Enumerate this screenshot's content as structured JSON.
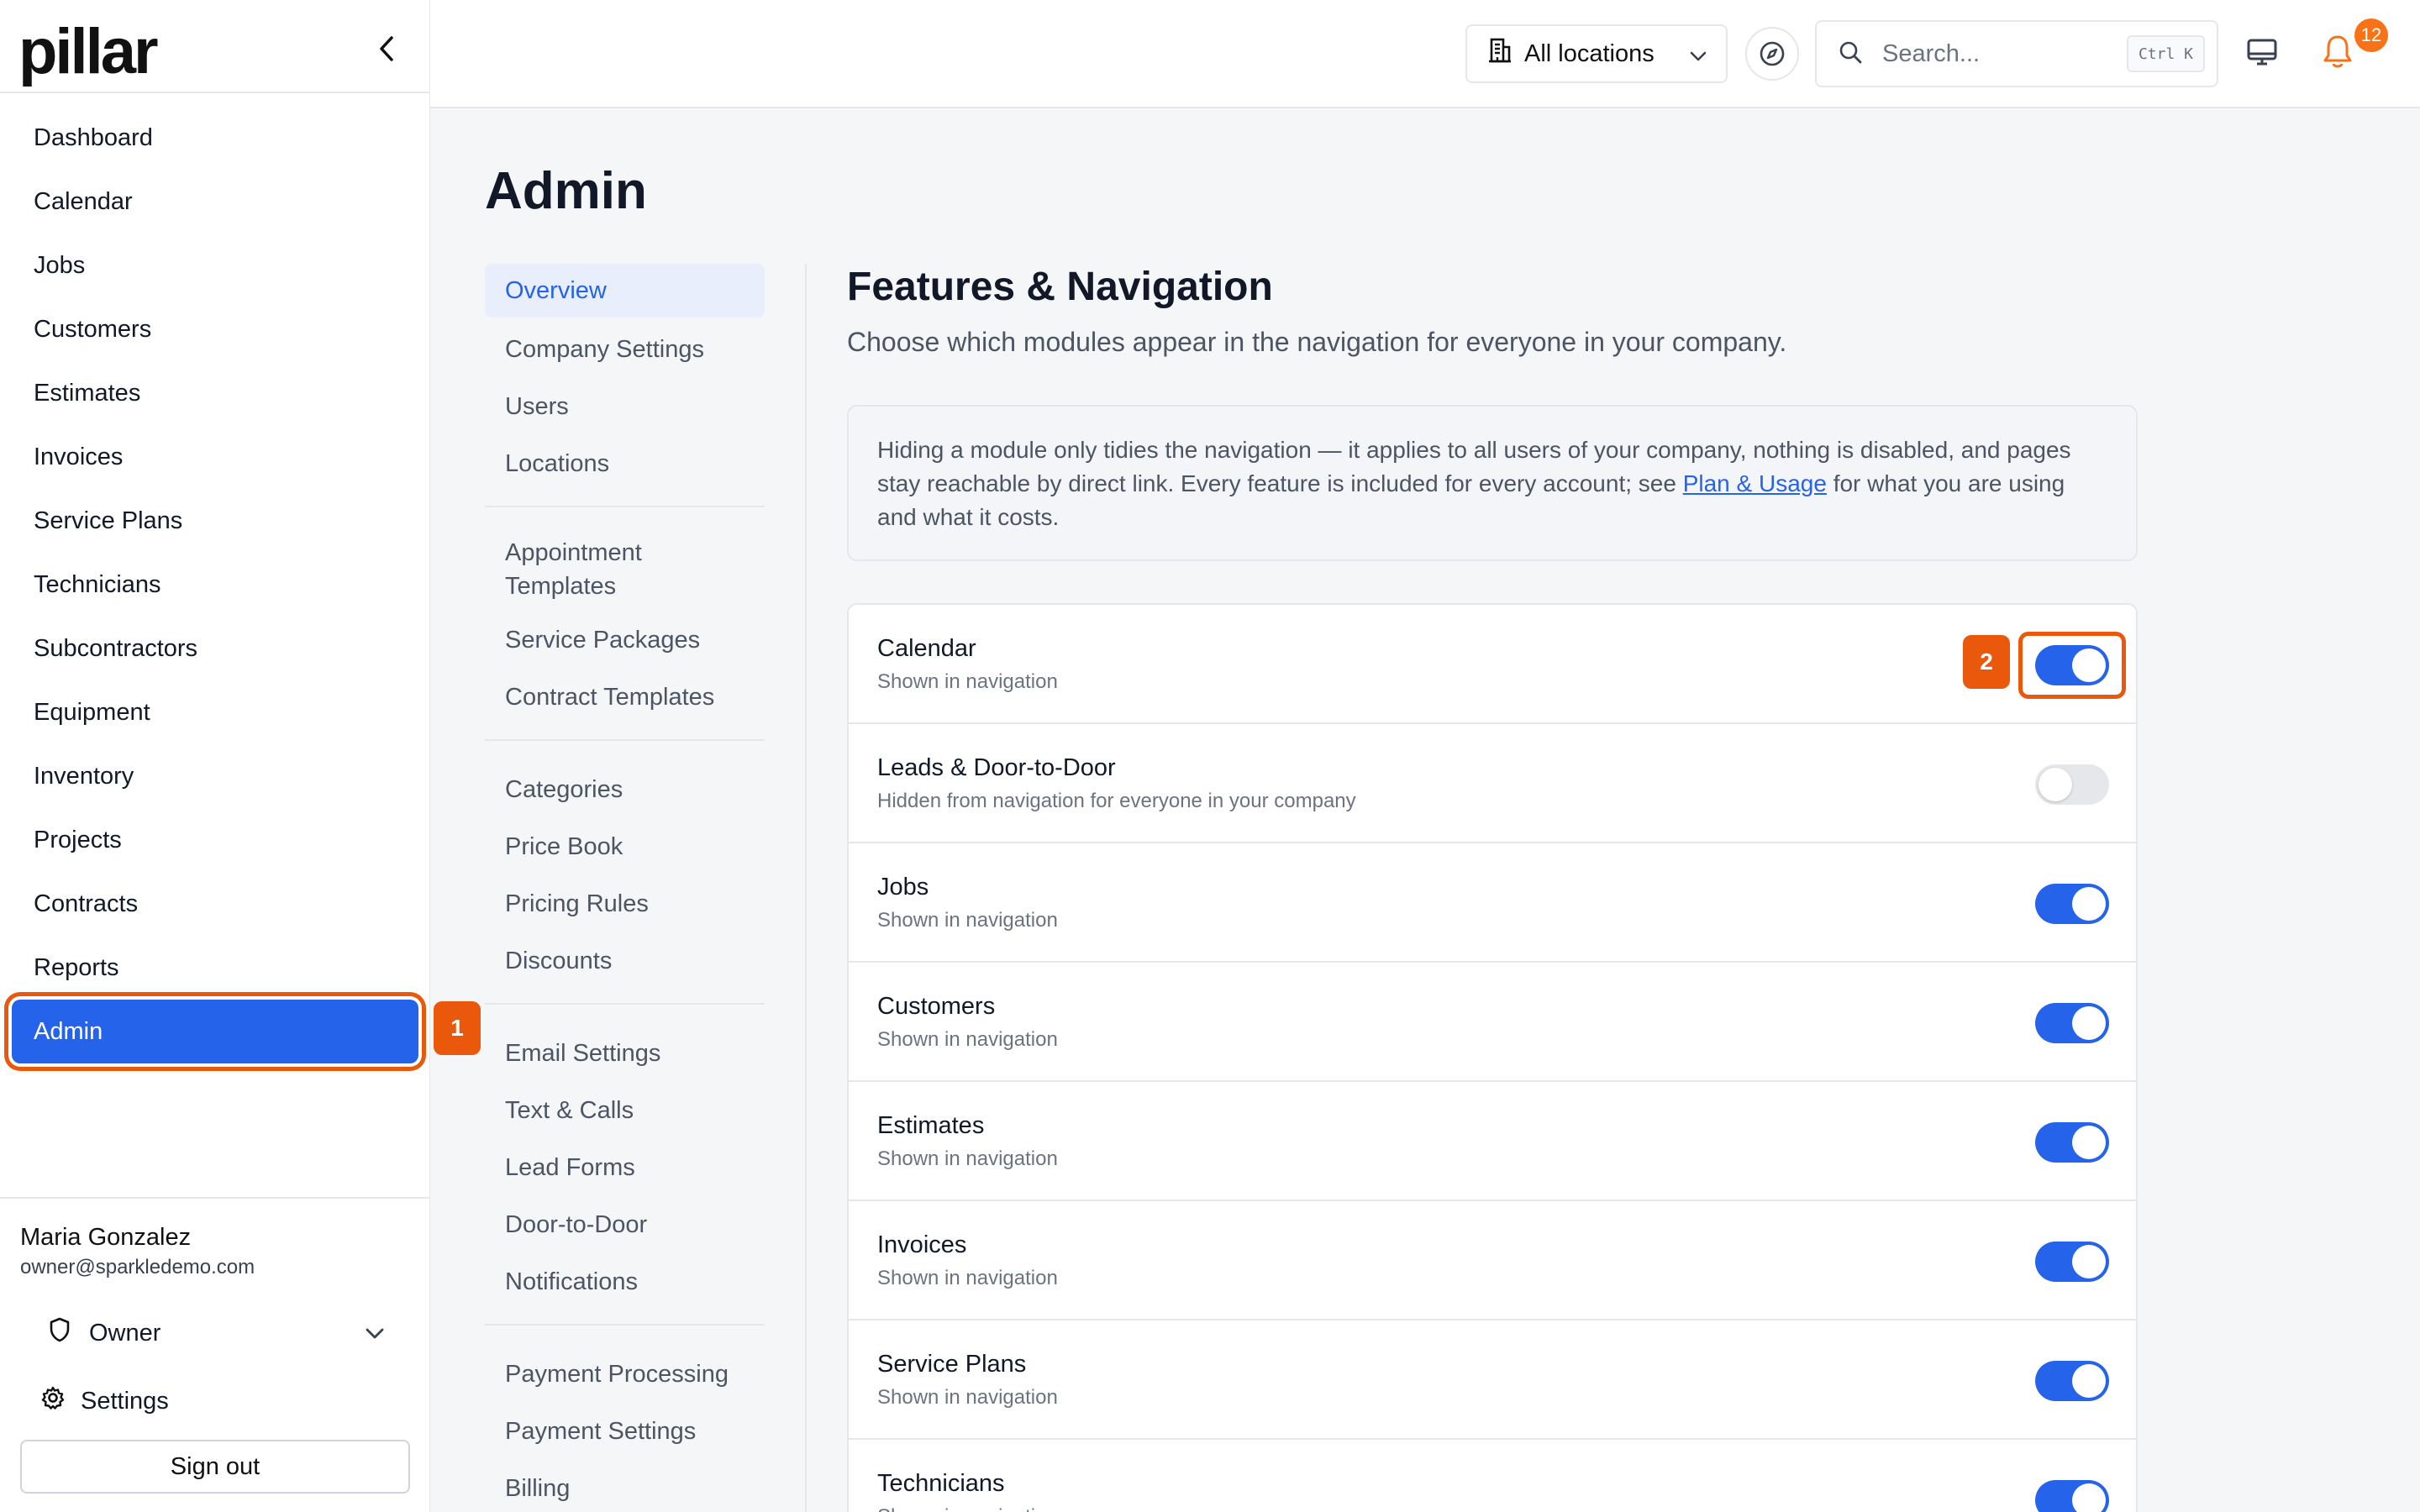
{
  "brand": {
    "logo_text": "pillar",
    "collapse_icon": "chevron-left-icon"
  },
  "sidebar": {
    "items": [
      {
        "label": "Dashboard"
      },
      {
        "label": "Calendar"
      },
      {
        "label": "Jobs"
      },
      {
        "label": "Customers"
      },
      {
        "label": "Estimates"
      },
      {
        "label": "Invoices"
      },
      {
        "label": "Service Plans"
      },
      {
        "label": "Technicians"
      },
      {
        "label": "Subcontractors"
      },
      {
        "label": "Equipment"
      },
      {
        "label": "Inventory"
      },
      {
        "label": "Projects"
      },
      {
        "label": "Contracts"
      },
      {
        "label": "Reports"
      },
      {
        "label": "Admin"
      }
    ],
    "active": "Admin",
    "step_badge": "1",
    "user": {
      "name": "Maria Gonzalez",
      "email": "owner@sparkledemo.com"
    },
    "role": "Owner",
    "settings_label": "Settings",
    "signout_label": "Sign out"
  },
  "topbar": {
    "location_label": "All locations",
    "search_placeholder": "Search...",
    "search_shortcut": "Ctrl K",
    "notifications_count": "12"
  },
  "page_title": "Admin",
  "subnav": {
    "groups": [
      [
        "Overview",
        "Company Settings",
        "Users",
        "Locations"
      ],
      [
        "Appointment Templates",
        "Service Packages",
        "Contract Templates"
      ],
      [
        "Categories",
        "Price Book",
        "Pricing Rules",
        "Discounts"
      ],
      [
        "Email Settings",
        "Text & Calls",
        "Lead Forms",
        "Door-to-Door",
        "Notifications"
      ],
      [
        "Payment Processing",
        "Payment Settings",
        "Billing"
      ]
    ],
    "active": "Overview"
  },
  "features": {
    "title": "Features & Navigation",
    "subtitle": "Choose which modules appear in the navigation for everyone in your company.",
    "info_text_before": "Hiding a module only tidies the navigation — it applies to all users of your company, nothing is disabled, and pages stay reachable by direct link. Every feature is included for every account; see ",
    "info_link": "Plan & Usage",
    "info_text_after": " for what you are using and what it costs.",
    "step_badge": "2",
    "modules": [
      {
        "name": "Calendar",
        "status": "Shown in navigation",
        "enabled": true
      },
      {
        "name": "Leads & Door-to-Door",
        "status": "Hidden from navigation for everyone in your company",
        "enabled": false
      },
      {
        "name": "Jobs",
        "status": "Shown in navigation",
        "enabled": true
      },
      {
        "name": "Customers",
        "status": "Shown in navigation",
        "enabled": true
      },
      {
        "name": "Estimates",
        "status": "Shown in navigation",
        "enabled": true
      },
      {
        "name": "Invoices",
        "status": "Shown in navigation",
        "enabled": true
      },
      {
        "name": "Service Plans",
        "status": "Shown in navigation",
        "enabled": true
      },
      {
        "name": "Technicians",
        "status": "Shown in navigation",
        "enabled": true
      }
    ]
  },
  "colors": {
    "primary": "#2563eb",
    "highlight": "#ea580c",
    "badge": "#f97316"
  }
}
